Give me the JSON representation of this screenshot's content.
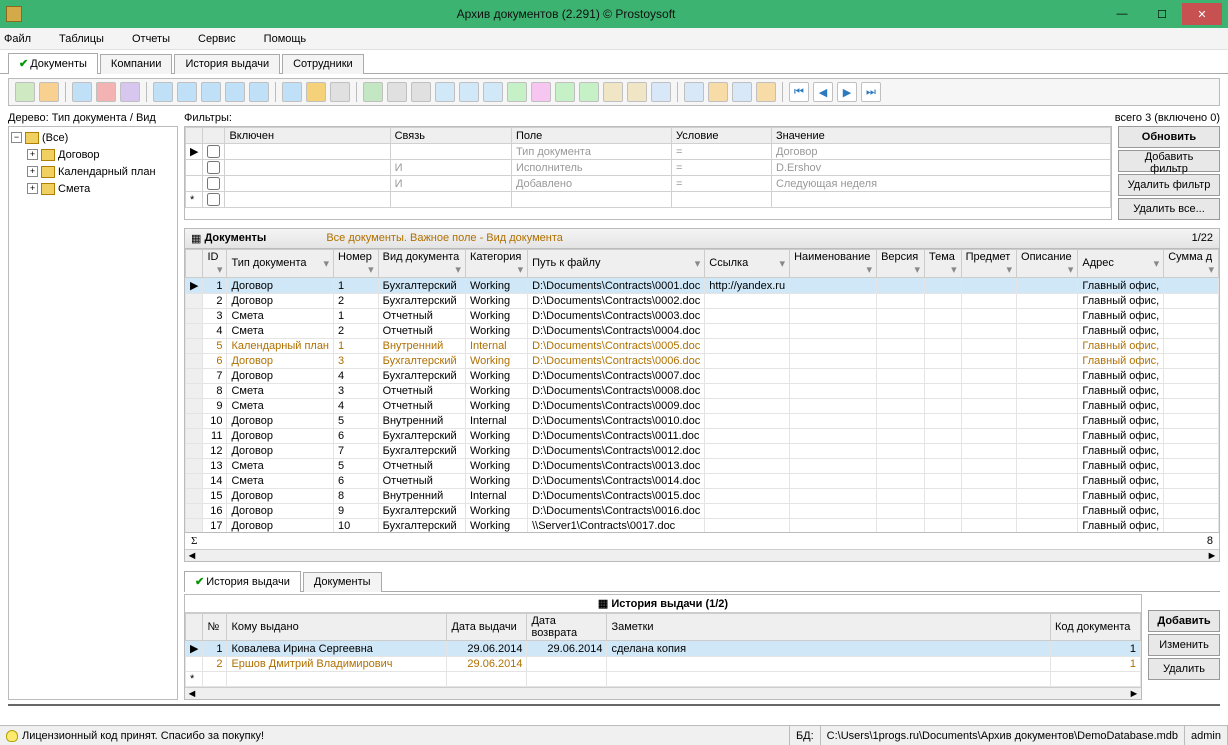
{
  "window": {
    "title": "Архив документов (2.291) © Prostoysoft"
  },
  "menubar": [
    "Файл",
    "Таблицы",
    "Отчеты",
    "Сервис",
    "Помощь"
  ],
  "main_tabs": {
    "active": 0,
    "items": [
      "Документы",
      "Компании",
      "История выдачи",
      "Сотрудники"
    ]
  },
  "tree": {
    "label": "Дерево: Тип документа / Вид",
    "root": "(Все)",
    "children": [
      "Договор",
      "Календарный план",
      "Смета"
    ]
  },
  "filters": {
    "label": "Фильтры:",
    "total_label": "всего 3 (включено 0)",
    "headers": [
      "Включен",
      "Связь",
      "Поле",
      "Условие",
      "Значение"
    ],
    "rows": [
      {
        "link": "",
        "field": "Тип документа",
        "cond": "=",
        "value": "Договор"
      },
      {
        "link": "И",
        "field": "Исполнитель",
        "cond": "=",
        "value": "D.Ershov"
      },
      {
        "link": "И",
        "field": "Добавлено",
        "cond": "=",
        "value": "Следующая неделя"
      }
    ],
    "buttons": {
      "refresh": "Обновить",
      "add": "Добавить фильтр",
      "del": "Удалить фильтр",
      "delall": "Удалить все..."
    }
  },
  "grid": {
    "title": "Документы",
    "subtitle": "Все документы. Важное поле - Вид документа",
    "pager": "1/22",
    "columns": [
      "ID",
      "Тип документа",
      "Номер",
      "Вид документа",
      "Категория",
      "Путь к файлу",
      "Ссылка",
      "Наименование",
      "Версия",
      "Тема",
      "Предмет",
      "Описание",
      "Адрес",
      "Сумма д"
    ],
    "rows": [
      {
        "id": 1,
        "type": "Договор",
        "num": "1",
        "kind": "Бухгалтерский",
        "cat": "Working",
        "path": "D:\\Documents\\Contracts\\0001.doc",
        "link": "http://yandex.ru",
        "addr": "Главный офис,",
        "sel": true
      },
      {
        "id": 2,
        "type": "Договор",
        "num": "2",
        "kind": "Бухгалтерский",
        "cat": "Working",
        "path": "D:\\Documents\\Contracts\\0002.doc",
        "link": "",
        "addr": "Главный офис,"
      },
      {
        "id": 3,
        "type": "Смета",
        "num": "1",
        "kind": "Отчетный",
        "cat": "Working",
        "path": "D:\\Documents\\Contracts\\0003.doc",
        "link": "",
        "addr": "Главный офис,"
      },
      {
        "id": 4,
        "type": "Смета",
        "num": "2",
        "kind": "Отчетный",
        "cat": "Working",
        "path": "D:\\Documents\\Contracts\\0004.doc",
        "link": "",
        "addr": "Главный офис,"
      },
      {
        "id": 5,
        "type": "Календарный план",
        "num": "1",
        "kind": "Внутренний",
        "cat": "Internal",
        "path": "D:\\Documents\\Contracts\\0005.doc",
        "link": "",
        "addr": "Главный офис,",
        "hl": true
      },
      {
        "id": 6,
        "type": "Договор",
        "num": "3",
        "kind": "Бухгалтерский",
        "cat": "Working",
        "path": "D:\\Documents\\Contracts\\0006.doc",
        "link": "",
        "addr": "Главный офис,",
        "hl": true
      },
      {
        "id": 7,
        "type": "Договор",
        "num": "4",
        "kind": "Бухгалтерский",
        "cat": "Working",
        "path": "D:\\Documents\\Contracts\\0007.doc",
        "link": "",
        "addr": "Главный офис,"
      },
      {
        "id": 8,
        "type": "Смета",
        "num": "3",
        "kind": "Отчетный",
        "cat": "Working",
        "path": "D:\\Documents\\Contracts\\0008.doc",
        "link": "",
        "addr": "Главный офис,"
      },
      {
        "id": 9,
        "type": "Смета",
        "num": "4",
        "kind": "Отчетный",
        "cat": "Working",
        "path": "D:\\Documents\\Contracts\\0009.doc",
        "link": "",
        "addr": "Главный офис,"
      },
      {
        "id": 10,
        "type": "Договор",
        "num": "5",
        "kind": "Внутренний",
        "cat": "Internal",
        "path": "D:\\Documents\\Contracts\\0010.doc",
        "link": "",
        "addr": "Главный офис,"
      },
      {
        "id": 11,
        "type": "Договор",
        "num": "6",
        "kind": "Бухгалтерский",
        "cat": "Working",
        "path": "D:\\Documents\\Contracts\\0011.doc",
        "link": "",
        "addr": "Главный офис,"
      },
      {
        "id": 12,
        "type": "Договор",
        "num": "7",
        "kind": "Бухгалтерский",
        "cat": "Working",
        "path": "D:\\Documents\\Contracts\\0012.doc",
        "link": "",
        "addr": "Главный офис,"
      },
      {
        "id": 13,
        "type": "Смета",
        "num": "5",
        "kind": "Отчетный",
        "cat": "Working",
        "path": "D:\\Documents\\Contracts\\0013.doc",
        "link": "",
        "addr": "Главный офис,"
      },
      {
        "id": 14,
        "type": "Смета",
        "num": "6",
        "kind": "Отчетный",
        "cat": "Working",
        "path": "D:\\Documents\\Contracts\\0014.doc",
        "link": "",
        "addr": "Главный офис,"
      },
      {
        "id": 15,
        "type": "Договор",
        "num": "8",
        "kind": "Внутренний",
        "cat": "Internal",
        "path": "D:\\Documents\\Contracts\\0015.doc",
        "link": "",
        "addr": "Главный офис,"
      },
      {
        "id": 16,
        "type": "Договор",
        "num": "9",
        "kind": "Бухгалтерский",
        "cat": "Working",
        "path": "D:\\Documents\\Contracts\\0016.doc",
        "link": "",
        "addr": "Главный офис,"
      },
      {
        "id": 17,
        "type": "Договор",
        "num": "10",
        "kind": "Бухгалтерский",
        "cat": "Working",
        "path": "\\\\Server1\\Contracts\\0017.doc",
        "link": "",
        "addr": "Главный офис,"
      }
    ],
    "sum_right": "8"
  },
  "sub_tabs": {
    "active": 0,
    "items": [
      "История выдачи",
      "Документы"
    ]
  },
  "history": {
    "title": "История выдачи (1/2)",
    "columns": [
      "№",
      "Кому выдано",
      "Дата выдачи",
      "Дата возврата",
      "Заметки",
      "Код документа"
    ],
    "rows": [
      {
        "n": 1,
        "who": "Ковалева Ирина Сергеевна",
        "out": "29.06.2014",
        "ret": "29.06.2014",
        "note": "сделана копия",
        "code": "1",
        "sel": true
      },
      {
        "n": 2,
        "who": "Ершов Дмитрий Владимирович",
        "out": "29.06.2014",
        "ret": "",
        "note": "",
        "code": "1",
        "hl": true
      }
    ],
    "buttons": {
      "add": "Добавить",
      "edit": "Изменить",
      "del": "Удалить"
    }
  },
  "status": {
    "license": "Лицензионный код принят. Спасибо за покупку!",
    "db_label": "БД:",
    "db_path": "C:\\Users\\1progs.ru\\Documents\\Архив документов\\DemoDatabase.mdb",
    "user": "admin"
  }
}
